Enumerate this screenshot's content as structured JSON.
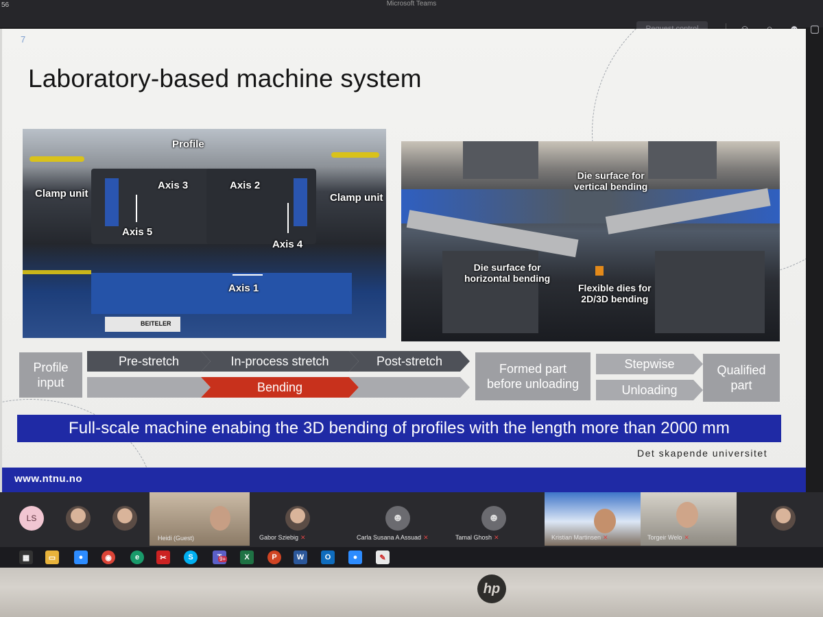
{
  "teams": {
    "clock": "56",
    "window_title": "Microsoft Teams",
    "request_control": "Request control",
    "icons": [
      "participants-icon",
      "chat-icon",
      "reactions-icon",
      "more-icon"
    ]
  },
  "slide": {
    "number": "7",
    "title": "Laboratory-based machine system",
    "left_photo_labels": {
      "profile": "Profile",
      "clamp_left": "Clamp unit",
      "axis3": "Axis 3",
      "axis2": "Axis 2",
      "axis5": "Axis 5",
      "clamp_right": "Clamp unit",
      "axis4": "Axis 4",
      "axis1": "Axis 1",
      "plate": "BEITELER"
    },
    "right_photo_labels": {
      "vertical": "Die surface for\nvertical bending",
      "horizontal": "Die surface for\nhorizontal bending",
      "flexible": "Flexible dies for\n2D/3D bending"
    },
    "flow": {
      "profile_input": "Profile\ninput",
      "pre_stretch": "Pre-stretch",
      "in_process": "In-process stretch",
      "post_stretch": "Post-stretch",
      "bending": "Bending",
      "formed_part": "Formed part\nbefore unloading",
      "stepwise": "Stepwise",
      "unloading": "Unloading",
      "qualified": "Qualified\npart"
    },
    "banner": "Full-scale machine enabing the 3D bending of profiles with the length more than 2000 mm",
    "university": "Det skapende universitet",
    "url": "www.ntnu.no"
  },
  "participants": [
    {
      "initials": "LS",
      "name": ""
    },
    {
      "name": ""
    },
    {
      "name": ""
    },
    {
      "name": "Heidi (Guest)"
    },
    {
      "name": "Gabor Sziebig"
    },
    {
      "name": "Carla Susana A Assuad"
    },
    {
      "name": "Tamal Ghosh"
    },
    {
      "name": "Kristian Martinsen"
    },
    {
      "name": "Torgeir Welo"
    },
    {
      "name": ""
    }
  ],
  "taskbar": {
    "icons": [
      "task-view-icon",
      "file-explorer-icon",
      "zoom-icon",
      "chrome-icon",
      "edge-icon",
      "snipping-icon",
      "skype-icon",
      "teams-icon",
      "excel-icon",
      "powerpoint-icon",
      "word-icon",
      "outlook-icon",
      "zoom-meetings-icon",
      "pdf-icon"
    ],
    "teams_badge": "9+"
  },
  "monitor_brand": "hp"
}
